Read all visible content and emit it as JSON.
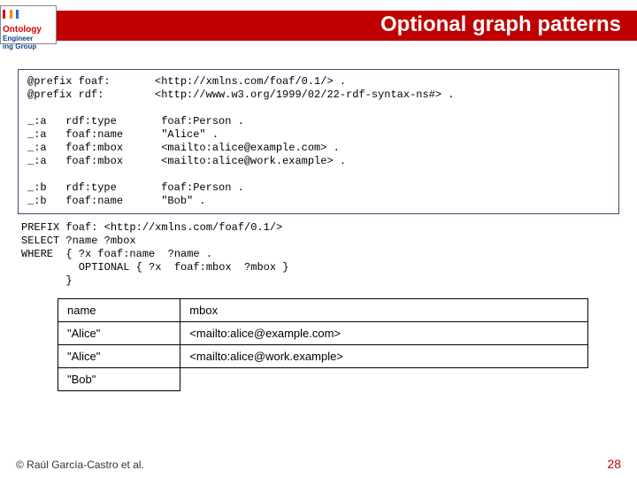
{
  "title": "Optional graph patterns",
  "logo": {
    "top": "Ontology",
    "mid": "Engineer",
    "bot": "ing Group"
  },
  "rdf_code": "@prefix foaf:       <http://xmlns.com/foaf/0.1/> .\n@prefix rdf:        <http://www.w3.org/1999/02/22-rdf-syntax-ns#> .\n\n_:a   rdf:type       foaf:Person .\n_:a   foaf:name      \"Alice\" .\n_:a   foaf:mbox      <mailto:alice@example.com> .\n_:a   foaf:mbox      <mailto:alice@work.example> .\n\n_:b   rdf:type       foaf:Person .\n_:b   foaf:name      \"Bob\" .",
  "sparql_code": "PREFIX foaf: <http://xmlns.com/foaf/0.1/>\nSELECT ?name ?mbox\nWHERE  { ?x foaf:name  ?name .\n         OPTIONAL { ?x  foaf:mbox  ?mbox }\n       }",
  "results": {
    "headers": [
      "name",
      "mbox"
    ],
    "rows": [
      [
        "\"Alice\"",
        "<mailto:alice@example.com>"
      ],
      [
        "\"Alice\"",
        "<mailto:alice@work.example>"
      ],
      [
        "\"Bob\"",
        ""
      ]
    ]
  },
  "chart_data": {
    "type": "table",
    "columns": [
      "name",
      "mbox"
    ],
    "rows": [
      {
        "name": "\"Alice\"",
        "mbox": "<mailto:alice@example.com>"
      },
      {
        "name": "\"Alice\"",
        "mbox": "<mailto:alice@work.example>"
      },
      {
        "name": "\"Bob\"",
        "mbox": ""
      }
    ]
  },
  "footer": "© Raúl García-Castro et al.",
  "page_number": "28",
  "colors": {
    "accent": "#c00000",
    "border": "#3a4d73"
  }
}
